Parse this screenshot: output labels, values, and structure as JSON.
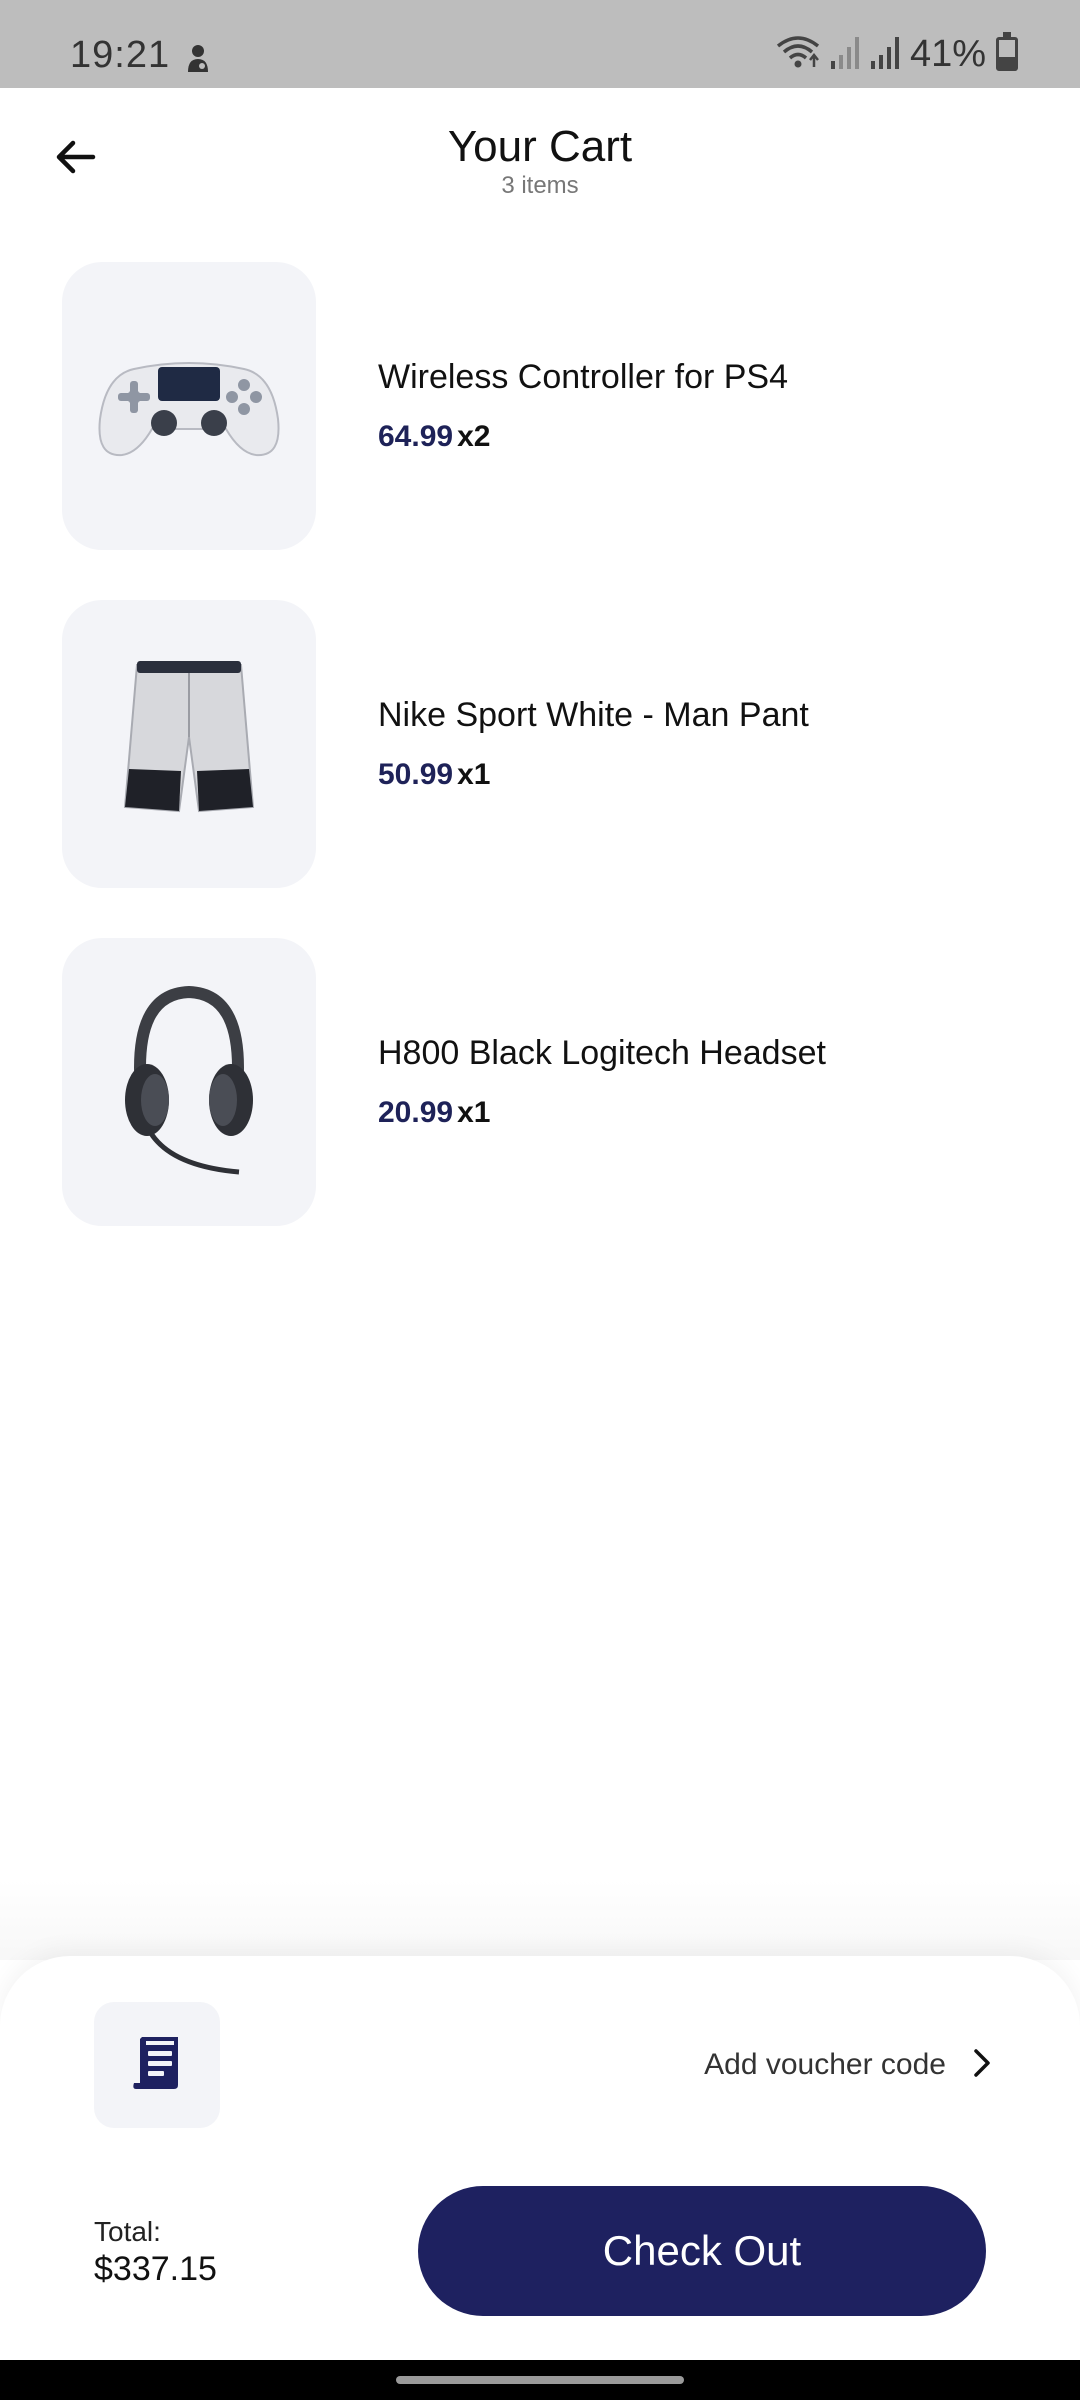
{
  "status_bar": {
    "time": "19:21",
    "battery_text": "41%",
    "battery_level": 0.41,
    "icons": [
      "person-icon",
      "wifi-icon",
      "signal-icon",
      "signal-icon",
      "battery-icon"
    ]
  },
  "header": {
    "title": "Your Cart",
    "subtitle": "3 items",
    "back_icon": "arrow-left-icon"
  },
  "cart": {
    "items": [
      {
        "name": "Wireless Controller for PS4",
        "price": "64.99",
        "qty": "x2",
        "image": "gamepad-image"
      },
      {
        "name": "Nike Sport White - Man Pant",
        "price": "50.99",
        "qty": "x1",
        "image": "shorts-image"
      },
      {
        "name": "H800 Black Logitech Headset",
        "price": "20.99",
        "qty": "x1",
        "image": "headset-image"
      }
    ]
  },
  "footer": {
    "voucher_label": "Add voucher code",
    "voucher_icon": "receipt-icon",
    "total_label": "Total:",
    "total_value": "$337.15",
    "checkout_label": "Check Out"
  },
  "colors": {
    "accent": "#1e2160",
    "price": "#1e2258",
    "thumb_bg": "#f3f4f8",
    "status_bar_bg": "#bdbdbd"
  }
}
